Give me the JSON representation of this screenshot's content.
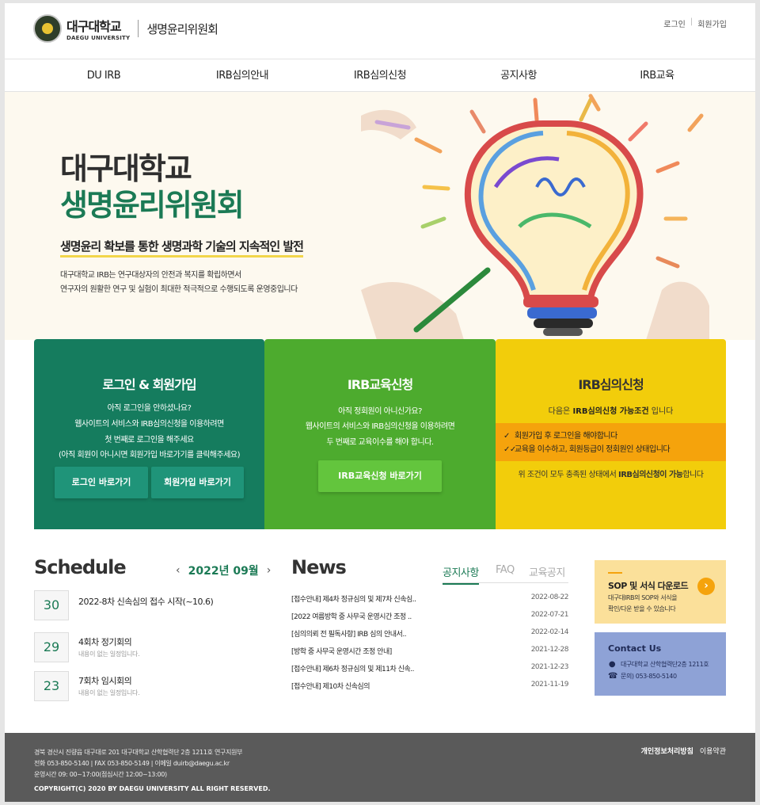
{
  "header": {
    "logo_ko": "대구대학교",
    "logo_en": "DAEGU UNIVERSITY",
    "site_name": "생명윤리위원회",
    "util": [
      "로그인",
      "회원가입"
    ]
  },
  "nav": [
    "DU IRB",
    "IRB심의안내",
    "IRB심의신청",
    "공지사항",
    "IRB교육"
  ],
  "hero": {
    "title1": "대구대학교",
    "title2": "생명윤리위원회",
    "subtitle": "생명윤리 확보를 통한 생명과학 기술의 지속적인 발전",
    "desc1": "대구대학교 IRB는 연구대상자의 안전과 복지를 확립하면서",
    "desc2": "연구자의 원활한 연구 및 실험이 최대한 적극적으로 수행되도록 운영중입니다"
  },
  "panels": {
    "login": {
      "title": "로그인 & 회원가입",
      "lines": [
        "아직 로그인을 안하셨나요?",
        "웹사이트의 서비스와 IRB심의신청을 이용하려면",
        "첫 번째로 로그인을 해주세요",
        "(아직 회원이 아니시면 회원가입 바로가기를 클릭해주세요)"
      ],
      "btn1": "로그인 바로가기",
      "btn2": "회원가입 바로가기"
    },
    "edu": {
      "title": "IRB교육신청",
      "lines": [
        "아직 정회원이 아니신가요?",
        "웹사이트의 서비스와 IRB심의신청을 이용하려면",
        "두 번째로 교육이수를 해야 합니다."
      ],
      "btn": "IRB교육신청 바로가기"
    },
    "review": {
      "title": "IRB심의신청",
      "note_pre": "다음은 ",
      "note_bold": "IRB심의신청 가능조건",
      "note_post": " 입니다",
      "check1": "회원가입 후 로그인을 해야합니다",
      "check2": "교육을 이수하고, 회원등급이 정회원인 상태입니다",
      "foot_pre": "위 조건이 모두 충족된 상태에서 ",
      "foot_bold": "IRB심의신청이 가능",
      "foot_post": "합니다"
    }
  },
  "schedule": {
    "title": "Schedule",
    "month": "2022년 09월",
    "items": [
      {
        "day": "30",
        "name": "2022-8차 신속심의 접수 시작(~10.6)",
        "desc": ""
      },
      {
        "day": "29",
        "name": "4회차 정기회의",
        "desc": "내용이 없는 일정입니다."
      },
      {
        "day": "23",
        "name": "7회차 임시회의",
        "desc": "내용이 없는 일정입니다."
      }
    ]
  },
  "news": {
    "title": "News",
    "tabs": [
      "공지사항",
      "FAQ",
      "교육공지"
    ],
    "rows": [
      {
        "title": "[접수안내] 제4차 정규심의 및 제7차 신속심..",
        "date": "2022-08-22"
      },
      {
        "title": "[2022 여름방학 중 사무국 운영시간 조정 ..",
        "date": "2022-07-21"
      },
      {
        "title": "[심의의뢰 전 필독사항] IRB 심의 안내서..",
        "date": "2022-02-14"
      },
      {
        "title": "[방학 중 사무국 운영시간 조정 안내]",
        "date": "2021-12-28"
      },
      {
        "title": "[접수안내] 제6차 정규심의 및 제11차 신속..",
        "date": "2021-12-23"
      },
      {
        "title": "[접수안내] 제10차 신속심의",
        "date": "2021-11-19"
      }
    ]
  },
  "sop": {
    "title": "SOP 및 서식 다운로드",
    "desc1": "대구대IRB의 SOP와 서식을",
    "desc2": "확인/다운 받을 수 있습니다"
  },
  "contact": {
    "title": "Contact Us",
    "address": "대구대학교 산학협력단2층 1211호",
    "phone": "문의) 053-850-5140"
  },
  "footer": {
    "address": "경북 경산시 진량읍 대구대로 201 대구대학교 산학협력단 2층 1211호 연구지원부",
    "tel": "전화 053-850-5140 | FAX 053-850-5149 | 이메일 duirb@daegu.ac.kr",
    "hours": "운영시간 09: 00~17:00(점심시간 12:00~13:00)",
    "copyright": "COPYRIGHT(C) 2020 BY DAEGU UNIVERSITY ALL RIGHT RESERVED.",
    "privacy": "개인정보처리방침",
    "terms": "이용약관"
  },
  "colors": {
    "brand_green": "#1b7a55",
    "panel_login": "#157c5e",
    "panel_edu": "#4dab2e",
    "panel_review": "#f2cd0b",
    "accent_orange": "#f5a30c"
  }
}
